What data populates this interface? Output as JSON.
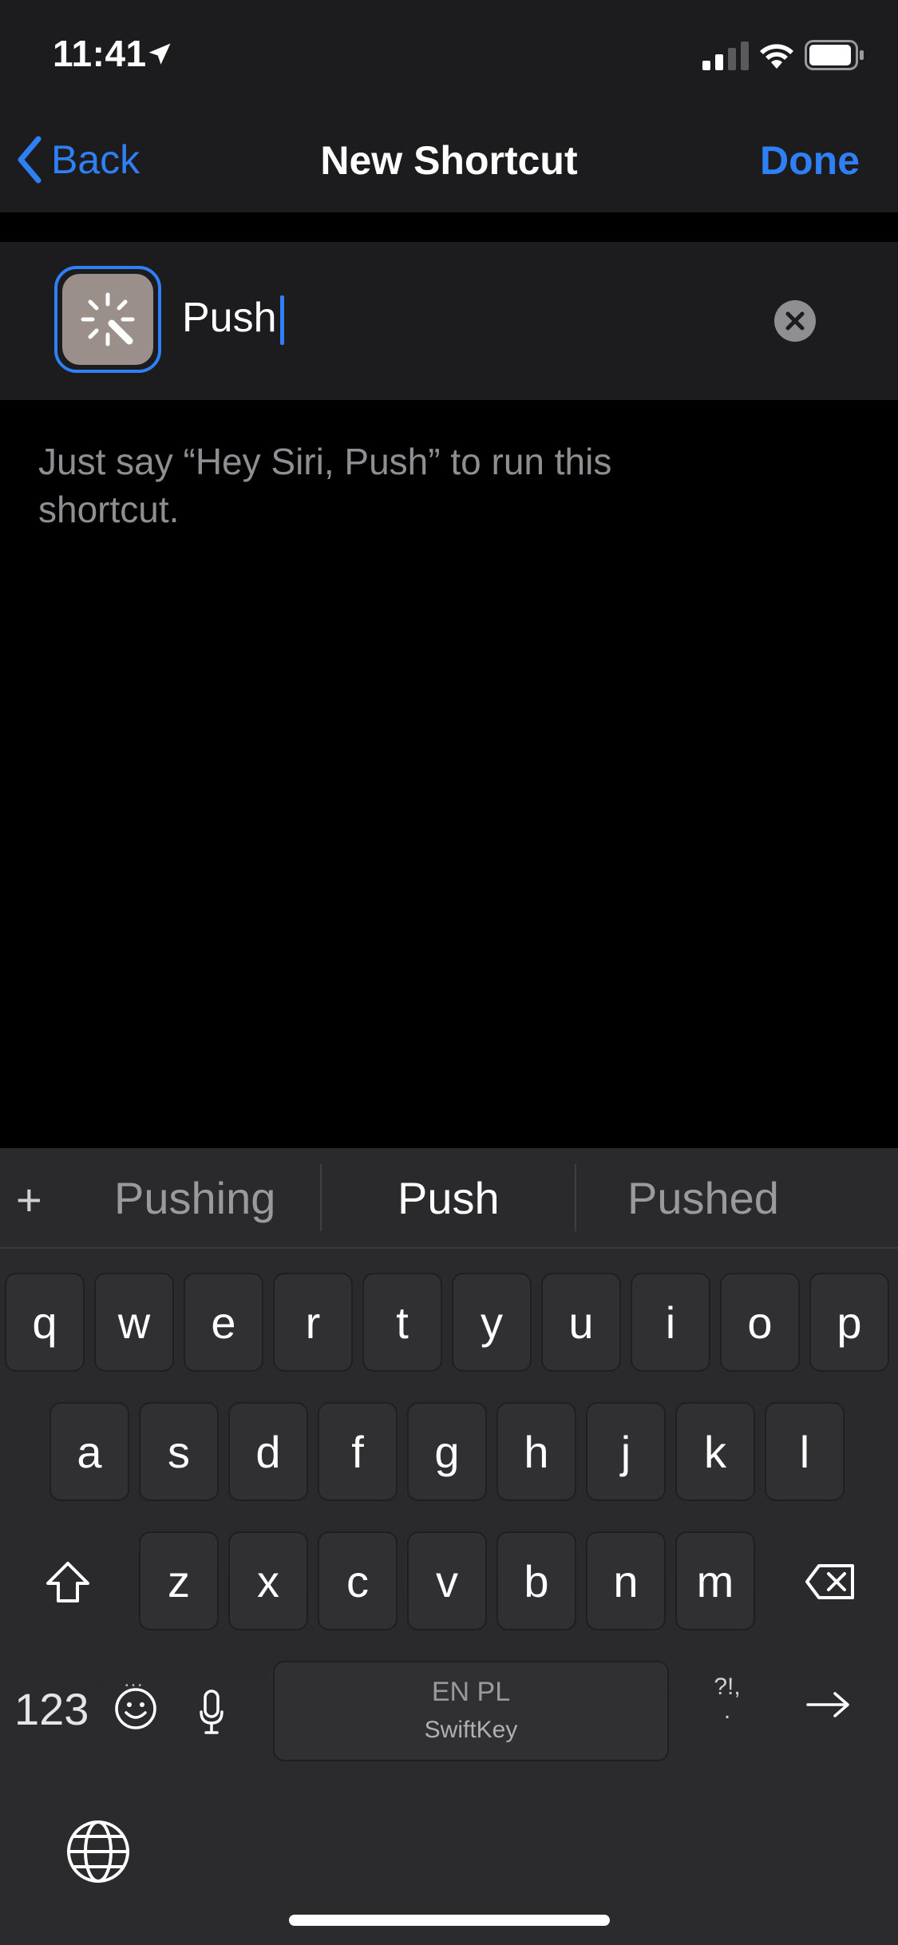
{
  "status_bar": {
    "time": "11:41"
  },
  "nav": {
    "back_label": "Back",
    "title": "New Shortcut",
    "done_label": "Done"
  },
  "shortcut": {
    "name": "Push",
    "icon": "magic-wand-icon"
  },
  "hint": "Just say “Hey Siri, Push” to run this shortcut.",
  "keyboard": {
    "suggestions": [
      "Pushing",
      "Push",
      "Pushed"
    ],
    "row1": [
      "q",
      "w",
      "e",
      "r",
      "t",
      "y",
      "u",
      "i",
      "o",
      "p"
    ],
    "row2": [
      "a",
      "s",
      "d",
      "f",
      "g",
      "h",
      "j",
      "k",
      "l"
    ],
    "row3": [
      "z",
      "x",
      "c",
      "v",
      "b",
      "n",
      "m"
    ],
    "numbers_label": "123",
    "space_language": "EN PL",
    "space_brand": "SwiftKey",
    "punct_label": "?!,",
    "punct_dot": "."
  },
  "colors": {
    "accent": "#2f7ff6",
    "bar_bg": "#1c1c1e",
    "keyboard_bg": "#2a2a2c"
  }
}
